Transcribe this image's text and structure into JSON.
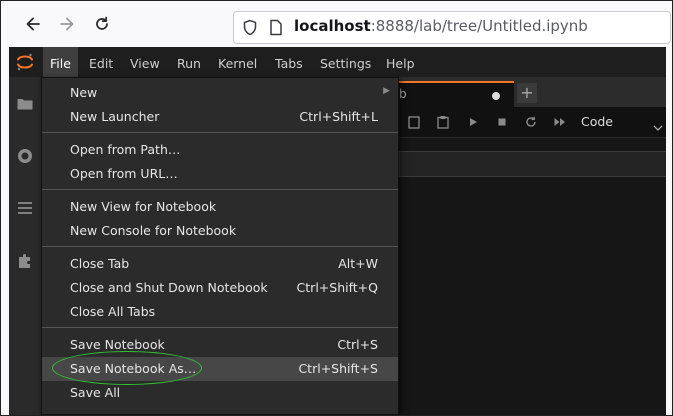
{
  "browser": {
    "url_host": "localhost",
    "url_rest": ":8888/lab/tree/Untitled.ipynb",
    "back_icon": "arrow-left-icon",
    "forward_icon": "arrow-right-icon",
    "reload_icon": "reload-icon"
  },
  "menubar": {
    "items": [
      "File",
      "Edit",
      "View",
      "Run",
      "Kernel",
      "Tabs",
      "Settings",
      "Help"
    ],
    "active": "File"
  },
  "tab": {
    "title": "b",
    "add_label": "+"
  },
  "toolbar": {
    "cell_type": "Code"
  },
  "file_menu": {
    "items": [
      {
        "label": "New",
        "shortcut": "",
        "submenu": true
      },
      {
        "label": "New Launcher",
        "shortcut": "Ctrl+Shift+L"
      },
      {
        "label": "Open from Path…",
        "shortcut": ""
      },
      {
        "label": "Open from URL…",
        "shortcut": ""
      },
      {
        "label": "New View for Notebook",
        "shortcut": ""
      },
      {
        "label": "New Console for Notebook",
        "shortcut": ""
      },
      {
        "label": "Close Tab",
        "shortcut": "Alt+W"
      },
      {
        "label": "Close and Shut Down Notebook",
        "shortcut": "Ctrl+Shift+Q"
      },
      {
        "label": "Close All Tabs",
        "shortcut": ""
      },
      {
        "label": "Save Notebook",
        "shortcut": "Ctrl+S"
      },
      {
        "label": "Save Notebook As…",
        "shortcut": "Ctrl+Shift+S",
        "highlighted": true
      },
      {
        "label": "Save All",
        "shortcut": ""
      }
    ]
  },
  "colors": {
    "accent": "#f37626",
    "annotation": "#31c131",
    "menu_bg": "#2b2b2b",
    "hover_bg": "#474747"
  }
}
